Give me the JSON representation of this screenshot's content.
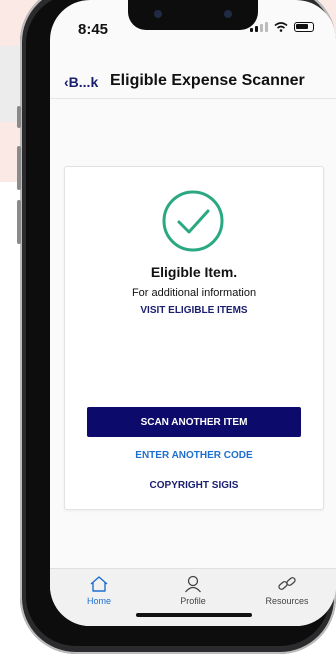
{
  "status": {
    "time": "8:45"
  },
  "nav": {
    "back_label": "B...k",
    "title": "Eligible Expense Scanner"
  },
  "result": {
    "title": "Eligible Item.",
    "info": "For additional information",
    "visit_link": "VISIT ELIGIBLE ITEMS"
  },
  "actions": {
    "scan_button": "SCAN ANOTHER ITEM",
    "enter_code": "ENTER ANOTHER CODE",
    "copyright": "COPYRIGHT SIGIS"
  },
  "tabbar": {
    "items": [
      {
        "label": "Home",
        "icon": "home-icon",
        "active": true
      },
      {
        "label": "Profile",
        "icon": "profile-icon",
        "active": false
      },
      {
        "label": "Resources",
        "icon": "link-icon",
        "active": false
      }
    ]
  },
  "colors": {
    "accent_green": "#2aa882",
    "primary_navy": "#0c0a6b",
    "link_blue": "#1f6fd0",
    "background_pink": "#fbe9e6"
  }
}
